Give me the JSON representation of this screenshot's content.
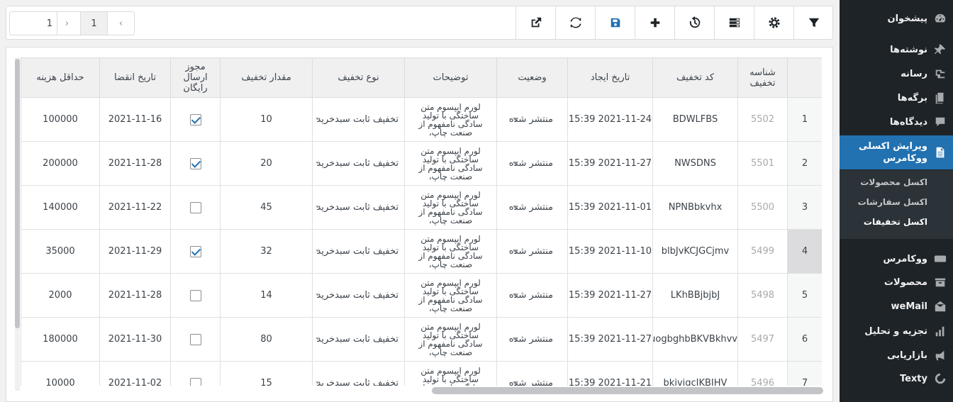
{
  "sidebar": {
    "items": [
      {
        "label": "پیشخوان",
        "icon": "dashboard-icon"
      },
      {
        "label": "نوشته‌ها",
        "icon": "pin-icon"
      },
      {
        "label": "رسانه",
        "icon": "media-icon"
      },
      {
        "label": "برگه‌ها",
        "icon": "pages-icon"
      },
      {
        "label": "دیدگاه‌ها",
        "icon": "comment-icon"
      },
      {
        "label": "ویرایش اکسلی ووکامرس",
        "icon": "document-icon"
      },
      {
        "label": "ووکامرس",
        "icon": "woo-icon"
      },
      {
        "label": "محصولات",
        "icon": "archive-icon"
      },
      {
        "label": "weMail",
        "icon": "mail-icon"
      },
      {
        "label": "تجزیه و تحلیل",
        "icon": "bar-chart-icon"
      },
      {
        "label": "بازاریابی",
        "icon": "megaphone-icon"
      },
      {
        "label": "Texty",
        "icon": "texty-icon"
      }
    ],
    "submenu": [
      "اکسل محصولات",
      "اکسل سفارشات",
      "اکسل تخفیفات"
    ]
  },
  "toolbar": {
    "buttons": [
      "filter-icon",
      "settings-icon",
      "columns-icon",
      "history-icon",
      "add-icon",
      "save-icon",
      "refresh-icon",
      "export-icon"
    ],
    "page_current": "1",
    "page_input": "1",
    "prev": "‹",
    "next": "›"
  },
  "table": {
    "headers": [
      "",
      "شناسه تخفیف",
      "کد تخفیف",
      "تاریخ ایجاد",
      "وضعیت",
      "توضیحات",
      "نوع تخفیف",
      "مقدار تخفیف",
      "مجوز ارسال رایگان",
      "تاریخ انقضا",
      "حداقل هزینه"
    ],
    "rows": [
      {
        "n": "1",
        "id": "5502",
        "code": "BDWLFBS",
        "date": "2021-11-24 15:39",
        "status": "منتشر شده",
        "desc": "لورم ایپسوم متن ساختگی با تولید سادگی نامفهوم از صنعت چاپ،",
        "type": "تخفیف ثابت سبدخرید",
        "amount": "10",
        "free": true,
        "expiry": "2021-11-16",
        "min": "100000"
      },
      {
        "n": "2",
        "id": "5501",
        "code": "NWSDNS",
        "date": "2021-11-27 15:39",
        "status": "منتشر شده",
        "desc": "لورم ایپسوم متن ساختگی با تولید سادگی نامفهوم از صنعت چاپ،",
        "type": "تخفیف ثابت سبدخرید",
        "amount": "20",
        "free": true,
        "expiry": "2021-11-28",
        "min": "200000"
      },
      {
        "n": "3",
        "id": "5500",
        "code": "NPNBbkvhx",
        "date": "2021-11-01 15:39",
        "status": "منتشر شده",
        "desc": "لورم ایپسوم متن ساختگی با تولید سادگی نامفهوم از صنعت چاپ،",
        "type": "تخفیف ثابت سبدخرید",
        "amount": "45",
        "free": false,
        "expiry": "2021-11-22",
        "min": "140000"
      },
      {
        "n": "4",
        "id": "5499",
        "code": "blbJvKCJGCjmv",
        "date": "2021-11-10 15:39",
        "status": "منتشر شده",
        "desc": "لورم ایپسوم متن ساختگی با تولید سادگی نامفهوم از صنعت چاپ،",
        "type": "تخفیف ثابت سبدخرید",
        "amount": "32",
        "free": true,
        "expiry": "2021-11-29",
        "min": "35000"
      },
      {
        "n": "5",
        "id": "5498",
        "code": "LKhBBjbjbJ",
        "date": "2021-11-27 15:39",
        "status": "منتشر شده",
        "desc": "لورم ایپسوم متن ساختگی با تولید سادگی نامفهوم از صنعت چاپ،",
        "type": "تخفیف ثابت سبدخرید",
        "amount": "14",
        "free": false,
        "expiry": "2021-11-28",
        "min": "2000"
      },
      {
        "n": "6",
        "id": "5497",
        "code": "uogbghbBKVBkhvv",
        "date": "2021-11-27 15:39",
        "status": "منتشر شده",
        "desc": "لورم ایپسوم متن ساختگی با تولید سادگی نامفهوم از صنعت چاپ،",
        "type": "تخفیف ثابت سبدخرید",
        "amount": "80",
        "free": false,
        "expiry": "2021-11-30",
        "min": "180000"
      },
      {
        "n": "7",
        "id": "5496",
        "code": "bkjvjgcJKBJHV",
        "date": "2021-11-21 15:39",
        "status": "منتشر شده",
        "desc": "لورم ایپسوم متن ساختگی با تولید سادگی نامفهوم از صنعت چاپ،",
        "type": "تخفیف ثابت سبدخرید",
        "amount": "15",
        "free": false,
        "expiry": "2021-11-02",
        "min": "10000"
      }
    ]
  },
  "colors": {
    "sidebar_bg": "#1d2327",
    "active": "#2271b1",
    "check": "#2271b1"
  }
}
